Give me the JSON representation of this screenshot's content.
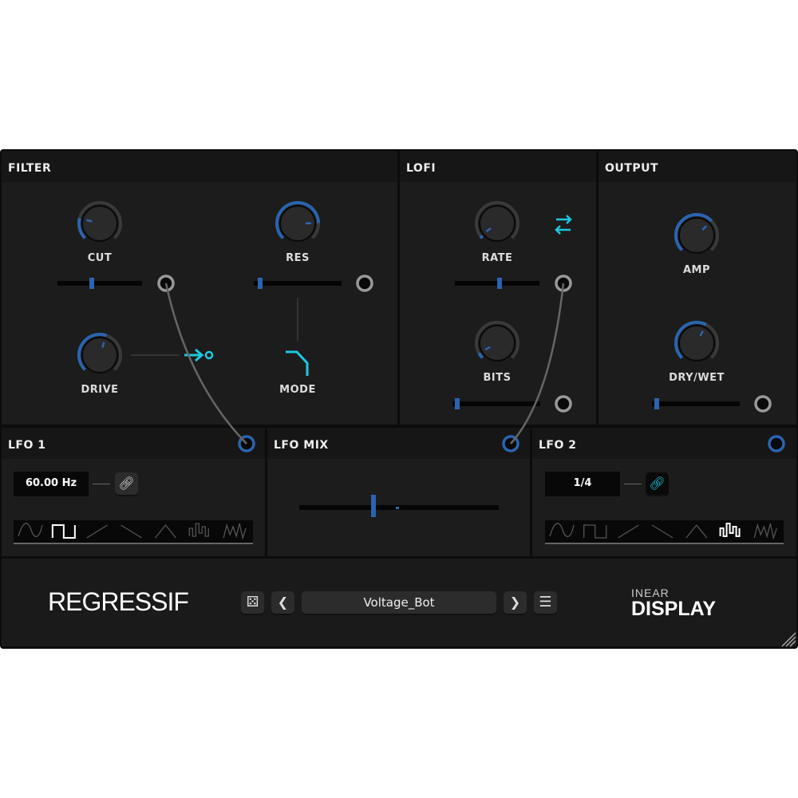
{
  "sections": {
    "filter": "FILTER",
    "lofi": "LOFI",
    "output": "OUTPUT",
    "lfo1": "LFO 1",
    "lfomix": "LFO MIX",
    "lfo2": "LFO 2"
  },
  "knobs": [
    {
      "id": "cut",
      "label": "CUT",
      "value": 0.22
    },
    {
      "id": "res",
      "label": "RES",
      "value": 0.83
    },
    {
      "id": "drive",
      "label": "DRIVE",
      "value": 0.57
    },
    {
      "id": "rate",
      "label": "RATE",
      "value": 0.03
    },
    {
      "id": "bits",
      "label": "BITS",
      "value": 0.06
    },
    {
      "id": "amp",
      "label": "AMP",
      "value": 0.67
    },
    {
      "id": "drywet",
      "label": "DRY/WET",
      "value": 0.6
    }
  ],
  "sliders": {
    "cut": 0.4,
    "res": 0.05,
    "rate": 0.53,
    "bits": 0.03,
    "drywet": 0.03,
    "lfomix": 0.37
  },
  "filter": {
    "mode_label": "MODE"
  },
  "lfo1": {
    "rate": "60.00 Hz",
    "sync": false,
    "selected_wave": 1
  },
  "lfo2": {
    "rate": "1/4",
    "sync": true,
    "selected_wave": 5
  },
  "waves": [
    "sine",
    "square",
    "saw-up",
    "saw-down",
    "triangle",
    "sample-hold",
    "random"
  ],
  "footer": {
    "logo": "REGRESSIF",
    "preset": "Voltage_Bot",
    "brand_top": "INEAR",
    "brand_bottom": "DISPLAY"
  },
  "colors": {
    "accent": "#2a64b0",
    "cyan": "#1ec8e0",
    "bg": "#1c1c1c"
  }
}
